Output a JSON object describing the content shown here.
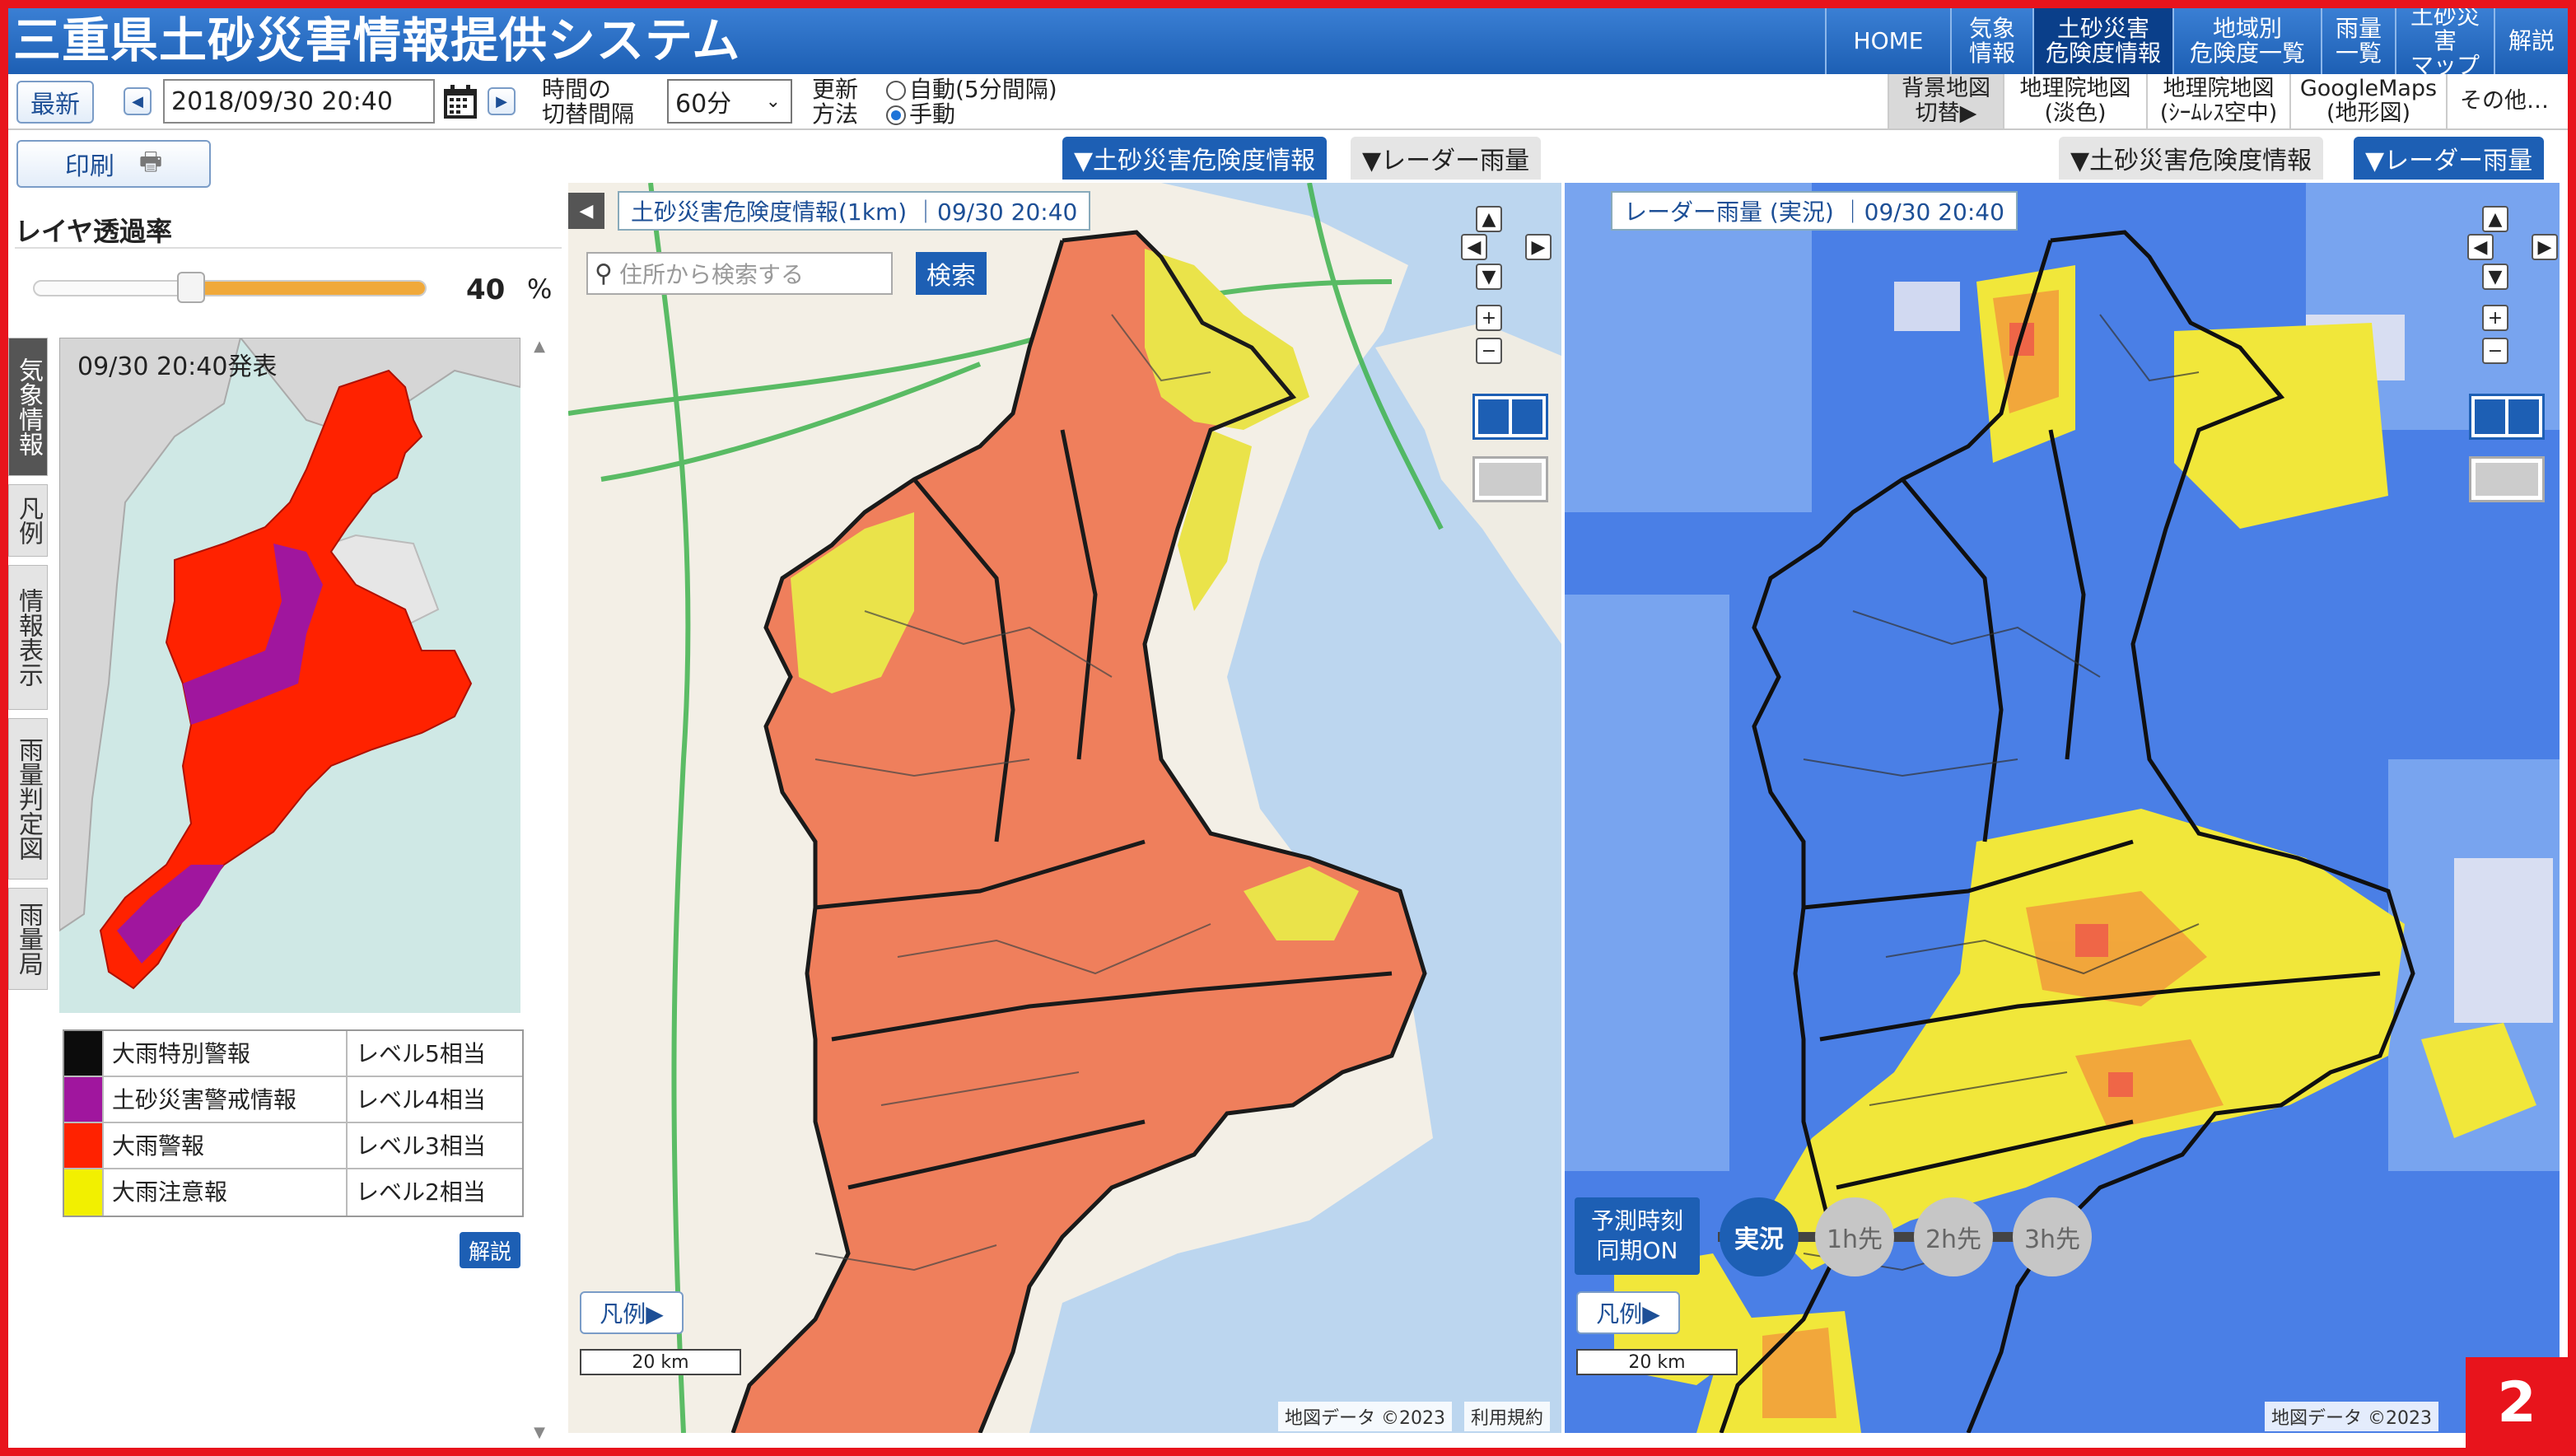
{
  "header": {
    "title": "三重県土砂災害情報提供システム",
    "nav": [
      "HOME",
      "気象\n情報",
      "土砂災害\n危険度情報",
      "地域別\n危険度一覧",
      "雨量\n一覧",
      "土砂災害\nマップ",
      "解説"
    ]
  },
  "toolbar": {
    "latest": "最新",
    "datetime": "2018/09/30 20:40",
    "interval_label": "時間の\n切替間隔",
    "interval_value": "60分",
    "update_label": "更新\n方法",
    "auto": "自動(5分間隔)",
    "manual": "手動",
    "basemap_label": "背景地図\n切替▶",
    "basemaps": [
      "地理院地図\n(淡色)",
      "地理院地図\n(ｼｰﾑﾚｽ空中)",
      "GoogleMaps\n(地形図)",
      "その他…"
    ]
  },
  "sidebar": {
    "print": "印刷",
    "opacity_title": "レイヤ透過率",
    "opacity_value": "40",
    "opacity_unit": "%",
    "opacity_fraction": 0.4,
    "vtabs": [
      "気象情報",
      "凡例",
      "情報表示",
      "雨量判定図",
      "雨量局"
    ],
    "minimap_time": "09/30 20:40発表",
    "legend": [
      {
        "name": "大雨特別警報",
        "level": "レベル5相当",
        "color": "#0c0c0c"
      },
      {
        "name": "土砂災害警戒情報",
        "level": "レベル4相当",
        "color": "#a0169e"
      },
      {
        "name": "大雨警報",
        "level": "レベル3相当",
        "color": "#ff2200"
      },
      {
        "name": "大雨注意報",
        "level": "レベル2相当",
        "color": "#f2f000"
      }
    ],
    "explain": "解説"
  },
  "left_panel": {
    "tab_active": "▼土砂災害危険度情報",
    "tab_other": "▼レーダー雨量",
    "map_label": "土砂災害危険度情報(1km) ｜09/30 20:40",
    "search_placeholder": "住所から検索する",
    "search_button": "検索",
    "legend_button": "凡例▶",
    "scale": "20 km",
    "attribution": "地図データ ©2023",
    "terms": "利用規約"
  },
  "right_panel": {
    "tab_other": "▼土砂災害危険度情報",
    "tab_active": "▼レーダー雨量",
    "map_label": "レーダー雨量 (実況) ｜09/30 20:40",
    "sync": "予測時刻\n同期ON",
    "steps": [
      "実況",
      "1h先",
      "2h先",
      "3h先"
    ],
    "legend_button": "凡例▶",
    "scale": "20 km",
    "attribution": "地図データ ©2023"
  },
  "corner_badge": "2",
  "colors": {
    "accent": "#1d5fb4",
    "frame": "#e8141c",
    "slider": "#f0a93a"
  }
}
